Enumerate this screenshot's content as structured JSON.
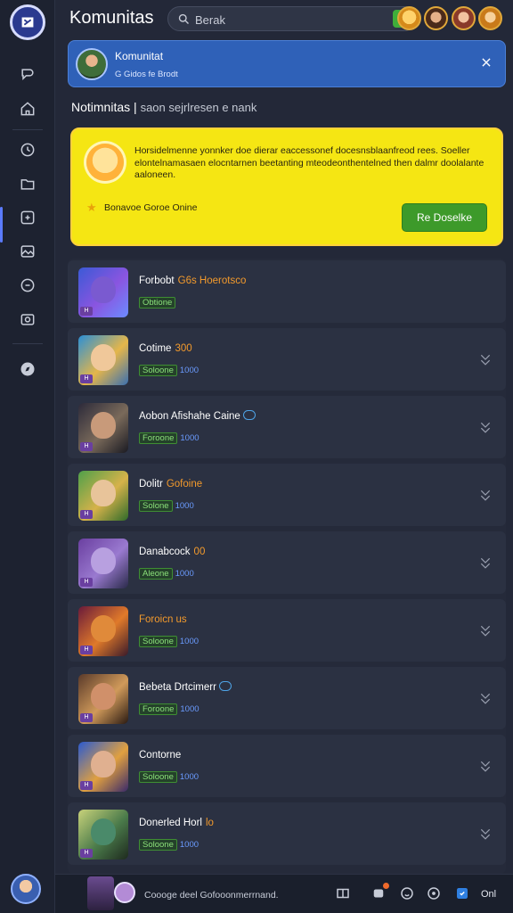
{
  "app": {
    "title": "Komunitas"
  },
  "search": {
    "placeholder": "Berak"
  },
  "banner": {
    "title": "Komunitat",
    "subtitle": "G Gidos fe Brodt"
  },
  "heading": {
    "title": "Notimnitas",
    "separator": "|",
    "subtitle": "saon sejrlresen e nank"
  },
  "promo": {
    "text": "Horsidelmenne yonnker doe dierar eaccessonef docesnsblaanfreod rees. Soeller elontelnamasaen elocntarnen beetanting mteodeonthentelned then dalmr doolalante aaloneen.",
    "label": "Bonavoe Goroe Onine",
    "button": "Re Doselke"
  },
  "rows": [
    {
      "title": "Forbobt",
      "accent": "G6s Hoerotsco",
      "group": "Obtione",
      "num": "",
      "tag": "H",
      "badge": false,
      "chevron": false
    },
    {
      "title": "Cotime",
      "accent": "300",
      "group": "Soloone",
      "num": "1000",
      "tag": "H",
      "badge": false,
      "chevron": true
    },
    {
      "title": "Aobon Afishahe Caine",
      "accent": "",
      "group": "Foroone",
      "num": "1000",
      "tag": "H",
      "badge": true,
      "chevron": true
    },
    {
      "title": "Dolitr",
      "accent": "Gofoine",
      "group": "Solone",
      "num": "1000",
      "tag": "H",
      "badge": false,
      "chevron": true
    },
    {
      "title": "Danabcock",
      "accent": "00",
      "group": "Aleone",
      "num": "1000",
      "tag": "H",
      "badge": false,
      "chevron": true
    },
    {
      "title": "",
      "accent": "Foroicn us",
      "group": "Soloone",
      "num": "1000",
      "tag": "H",
      "badge": false,
      "chevron": true
    },
    {
      "title": "Bebeta Drtcimerr",
      "accent": "",
      "group": "Foroone",
      "num": "1000",
      "tag": "H",
      "badge": true,
      "chevron": true
    },
    {
      "title": "Contorne",
      "accent": "",
      "group": "Soloone",
      "num": "1000",
      "tag": "H",
      "badge": false,
      "chevron": true
    },
    {
      "title": "Donerled Horl",
      "accent": "lo",
      "group": "Soloone",
      "num": "1000",
      "tag": "H",
      "badge": false,
      "chevron": true
    }
  ],
  "bottom": {
    "status": "Coooge deel Gofooonmerrnand.",
    "online": "Onl"
  },
  "icons": {
    "logo": "app-logo-icon",
    "nav": [
      "chat-icon",
      "home-icon",
      "clock-icon",
      "folder-icon",
      "puzzle-icon",
      "gallery-icon",
      "controller-icon",
      "camera-icon",
      "compass-icon"
    ],
    "search": "search-icon",
    "go": "search-go-icon",
    "close": "close-icon",
    "chevron": "chevron-down-icon"
  },
  "colors": {
    "accent": "#5b7bff",
    "promo": "#f5e613",
    "cta": "#3d9a2a",
    "banner": "#2f61b8",
    "orange": "#f39a2c"
  }
}
